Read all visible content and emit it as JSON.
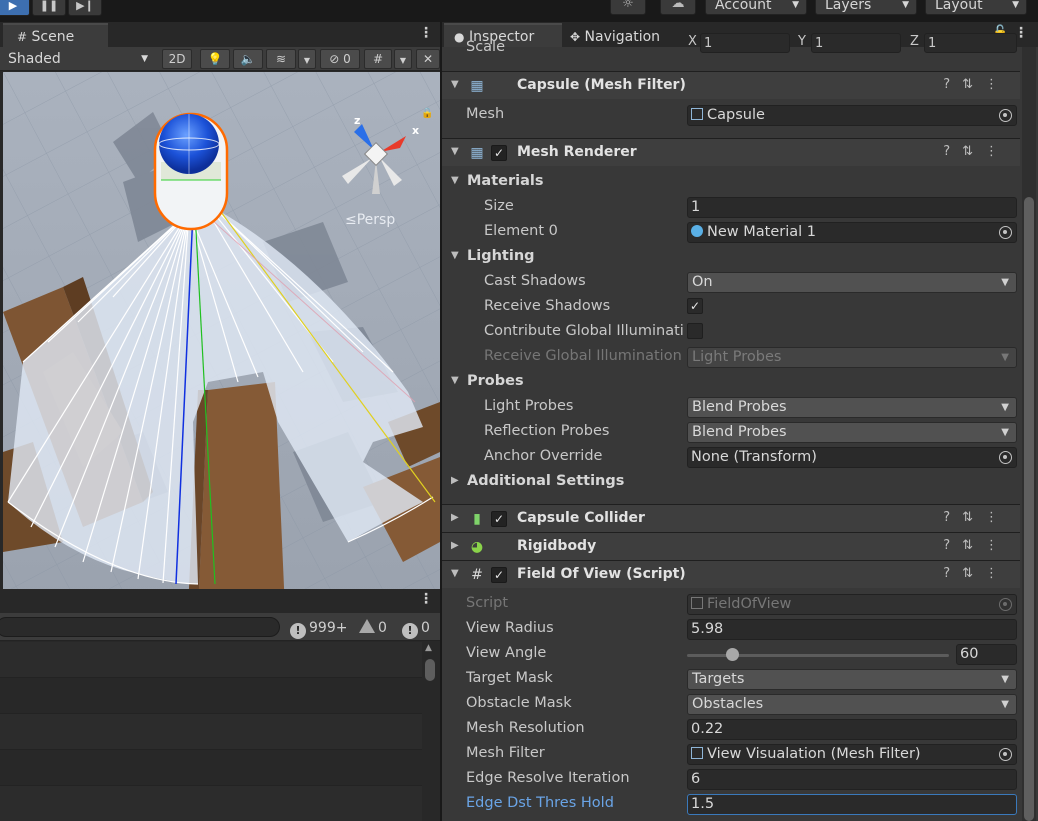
{
  "toolbar": {
    "account_label": "Account",
    "layers_label": "Layers",
    "layout_label": "Layout"
  },
  "scene": {
    "tab_label": "Scene",
    "shading_mode": "Shaded",
    "mode_2d": "2D",
    "hidden_count": "0",
    "projection_label": "Persp",
    "gizmo_axes": [
      "x",
      "z"
    ]
  },
  "console": {
    "log_count": "999+",
    "warning_count": "0",
    "error_count": "0"
  },
  "inspector": {
    "tabs": [
      "Inspector",
      "Navigation"
    ],
    "transform": {
      "scale_label": "Scale",
      "x_label": "X",
      "y_label": "Y",
      "z_label": "Z",
      "x": "1",
      "y": "1",
      "z": "1"
    },
    "mesh_filter": {
      "title": "Capsule (Mesh Filter)",
      "mesh_label": "Mesh",
      "mesh_value": "Capsule"
    },
    "mesh_renderer": {
      "title": "Mesh Renderer",
      "materials_label": "Materials",
      "size_label": "Size",
      "size_value": "1",
      "element0_label": "Element 0",
      "element0_value": "New Material 1",
      "lighting_label": "Lighting",
      "cast_shadows_label": "Cast Shadows",
      "cast_shadows_value": "On",
      "receive_shadows_label": "Receive Shadows",
      "receive_shadows_checked": true,
      "contribute_gi_label": "Contribute Global Illuminatio",
      "receive_gi_label": "Receive Global Illumination",
      "receive_gi_value": "Light Probes",
      "probes_label": "Probes",
      "light_probes_label": "Light Probes",
      "light_probes_value": "Blend Probes",
      "reflection_probes_label": "Reflection Probes",
      "reflection_probes_value": "Blend Probes",
      "anchor_override_label": "Anchor Override",
      "anchor_override_value": "None (Transform)",
      "additional_settings_label": "Additional Settings"
    },
    "capsule_collider": {
      "title": "Capsule Collider"
    },
    "rigidbody": {
      "title": "Rigidbody"
    },
    "field_of_view": {
      "title": "Field Of View (Script)",
      "script_label": "Script",
      "script_value": "FieldOfView",
      "view_radius_label": "View Radius",
      "view_radius_value": "5.98",
      "view_angle_label": "View Angle",
      "view_angle_value": "60",
      "view_angle_fraction": 0.17,
      "target_mask_label": "Target Mask",
      "target_mask_value": "Targets",
      "obstacle_mask_label": "Obstacle Mask",
      "obstacle_mask_value": "Obstacles",
      "mesh_resolution_label": "Mesh Resolution",
      "mesh_resolution_value": "0.22",
      "mesh_filter_label": "Mesh Filter",
      "mesh_filter_value": "View Visualation (Mesh Filter)",
      "edge_resolve_label": "Edge Resolve Iteration",
      "edge_resolve_value": "6",
      "edge_dst_label": "Edge Dst Thres Hold",
      "edge_dst_value": "1.5"
    }
  },
  "colors": {
    "accent": "#3a79bb",
    "play_active": "#3d6fb0",
    "panel": "#383838",
    "field": "#2a2a2a",
    "edited_label": "#6aa4e6"
  }
}
